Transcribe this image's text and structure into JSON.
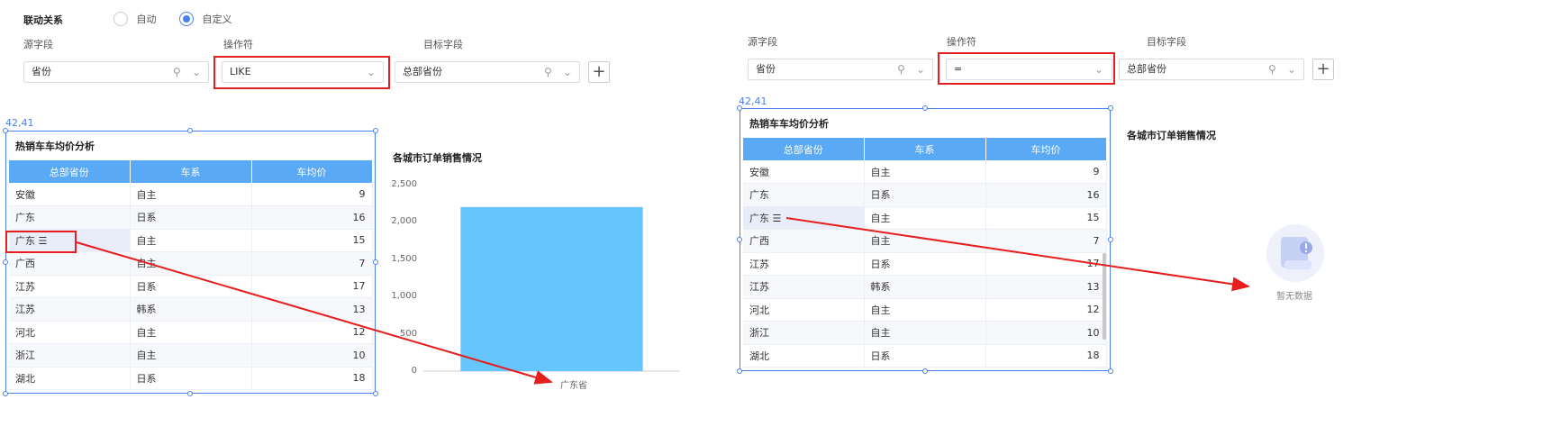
{
  "linkage": {
    "label": "联动关系",
    "options": [
      {
        "label": "自动",
        "selected": false
      },
      {
        "label": "自定义",
        "selected": true
      }
    ]
  },
  "left_panel": {
    "source_label": "源字段",
    "operator_label": "操作符",
    "target_label": "目标字段",
    "source_value": "省份",
    "operator_value": "LIKE",
    "target_value": "总部省份",
    "coord": "42,41",
    "table_title": "热销车车均价分析",
    "columns": [
      "总部省份",
      "车系",
      "车均价"
    ],
    "rows": [
      [
        "安徽",
        "自主",
        "9"
      ],
      [
        "广东",
        "日系",
        "16"
      ],
      [
        "广东 ☰",
        "自主",
        "15"
      ],
      [
        "广西",
        "自主",
        "7"
      ],
      [
        "江苏",
        "日系",
        "17"
      ],
      [
        "江苏",
        "韩系",
        "13"
      ],
      [
        "河北",
        "自主",
        "12"
      ],
      [
        "浙江",
        "自主",
        "10"
      ],
      [
        "湖北",
        "日系",
        "18"
      ]
    ],
    "chart_title": "各城市订单销售情况"
  },
  "right_panel": {
    "source_label": "源字段",
    "operator_label": "操作符",
    "target_label": "目标字段",
    "source_value": "省份",
    "operator_value": "=",
    "target_value": "总部省份",
    "coord": "42,41",
    "table_title": "热销车车均价分析",
    "columns": [
      "总部省份",
      "车系",
      "车均价"
    ],
    "rows": [
      [
        "安徽",
        "自主",
        "9"
      ],
      [
        "广东",
        "日系",
        "16"
      ],
      [
        "广东 ☰",
        "自主",
        "15"
      ],
      [
        "广西",
        "自主",
        "7"
      ],
      [
        "江苏",
        "日系",
        "17"
      ],
      [
        "江苏",
        "韩系",
        "13"
      ],
      [
        "河北",
        "自主",
        "12"
      ],
      [
        "浙江",
        "自主",
        "10"
      ],
      [
        "湖北",
        "日系",
        "18"
      ]
    ],
    "chart_title": "各城市订单销售情况",
    "empty_text": "暂无数据"
  },
  "icons": {
    "search": "search-icon",
    "dropdown": "chevron-down-icon",
    "add": "plus-icon",
    "menu": "menu-icon",
    "empty": "empty-data-icon"
  },
  "colors": {
    "accent": "#4a7ff0",
    "header": "#5aa9f5",
    "bar": "#66c5fd",
    "highlight": "#e61e1e"
  },
  "chart_data": {
    "type": "bar",
    "title": "各城市订单销售情况",
    "categories": [
      "广东省"
    ],
    "series": [
      {
        "values": [
          2200
        ]
      }
    ],
    "yticks": [
      "0",
      "500",
      "1,000",
      "1,500",
      "2,000",
      "2,500"
    ],
    "ylim": [
      0,
      2500
    ],
    "xlabel": "",
    "ylabel": "",
    "grid": false,
    "legend": "none"
  }
}
